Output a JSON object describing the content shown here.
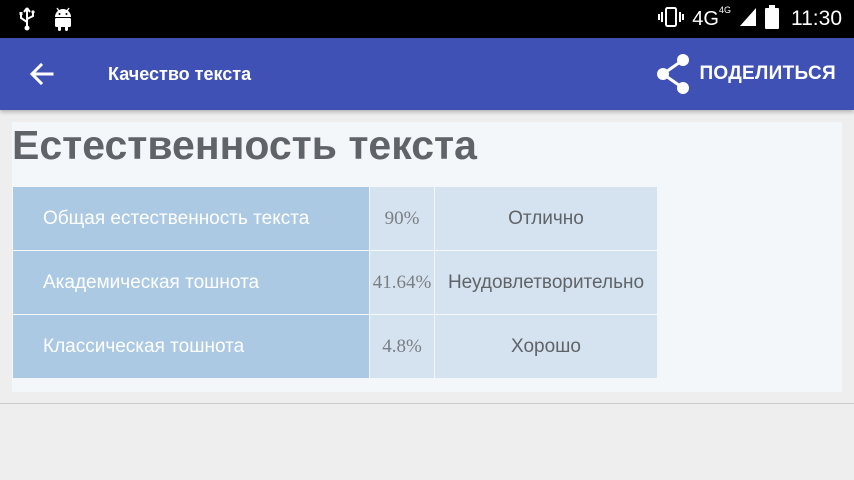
{
  "status_bar": {
    "network": "4G",
    "network_sup": "4G",
    "time": "11:30",
    "icons": [
      "usb-icon",
      "android-icon",
      "vibrate-icon",
      "signal-icon",
      "battery-icon"
    ]
  },
  "app_bar": {
    "title": "Качество текста",
    "share_label": "ПОДЕЛИТЬСЯ",
    "color": "#3f51b5"
  },
  "content": {
    "title": "Естественность текста",
    "rows": [
      {
        "name": "Общая естественность текста",
        "value": "90%",
        "rating": "Отлично"
      },
      {
        "name": "Академическая тошнота",
        "value": "41.64%",
        "rating": "Неудовлетворительно"
      },
      {
        "name": "Классическая тошнота",
        "value": "4.8%",
        "rating": "Хорошо"
      }
    ]
  }
}
